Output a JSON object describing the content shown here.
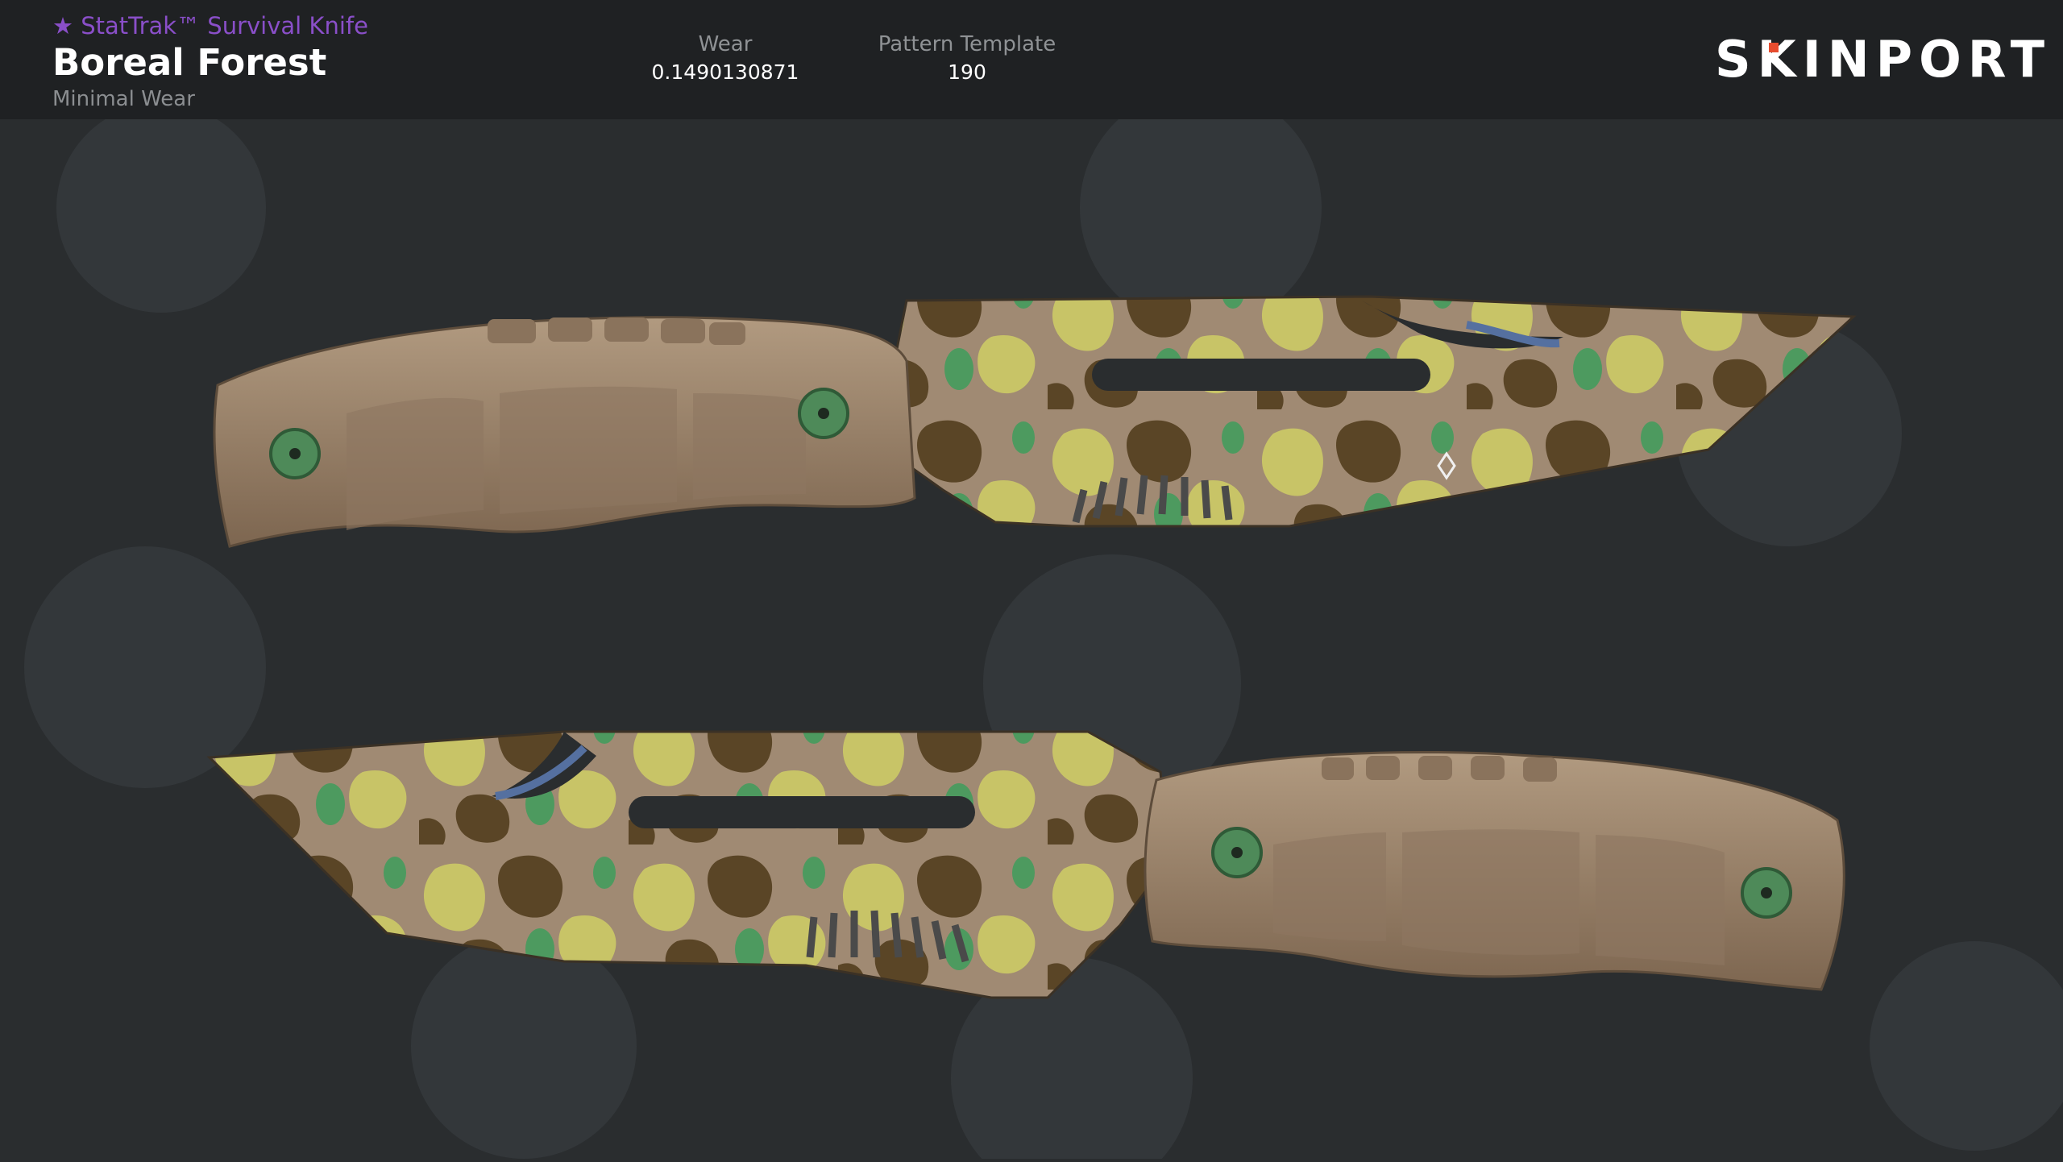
{
  "item": {
    "subtitle": "★ StatTrak™ Survival Knife",
    "name": "Boreal Forest",
    "quality": "Minimal Wear"
  },
  "stats": {
    "wear_label": "Wear",
    "wear_value": "0.1490130871",
    "pattern_label": "Pattern Template",
    "pattern_value": "190"
  },
  "brand": {
    "logo_text_before": "S",
    "logo_text_k": "K",
    "logo_text_after": "INPORT",
    "accent_color": "#e74c2e"
  },
  "colors": {
    "stattrak": "#8a4fc9",
    "header_bg": "#1f2123",
    "stage_bg": "#2a2d2f",
    "handle": "#9b8168",
    "camo_tan": "#a08a73",
    "camo_brown": "#5a4526",
    "camo_yellow": "#c8c467",
    "camo_green": "#4d9a5f"
  },
  "images": {
    "knife_top": "survival-knife-side-a",
    "knife_bottom": "survival-knife-side-b"
  }
}
